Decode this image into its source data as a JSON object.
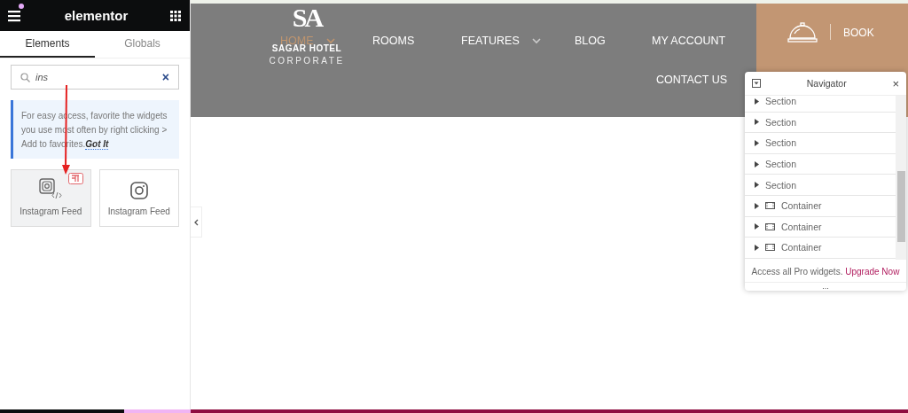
{
  "sidebar": {
    "title": "elementor",
    "tabs": [
      {
        "label": "Elements",
        "selected": true
      },
      {
        "label": "Globals",
        "selected": false
      }
    ],
    "search": {
      "value": "ins",
      "clear": "×"
    },
    "tip": {
      "text": "For easy access, favorite the widgets you use most often by right clicking > Add to favorites.",
      "link": "Got It"
    },
    "widgets": [
      {
        "label": "Instagram Feed",
        "kind": "code",
        "pro": true,
        "hovered": true
      },
      {
        "label": "Instagram Feed",
        "kind": "plain",
        "pro": false,
        "hovered": false
      }
    ]
  },
  "header": {
    "logo": {
      "mark": "SA",
      "name": "SAGAR HOTEL",
      "sub": "CORPORATE"
    },
    "nav": [
      {
        "label": "HOME",
        "selected": true,
        "dropdown": true
      },
      {
        "label": "ROOMS",
        "selected": false,
        "dropdown": false
      },
      {
        "label": "FEATURES",
        "selected": false,
        "dropdown": true
      },
      {
        "label": "BLOG",
        "selected": false,
        "dropdown": false
      },
      {
        "label": "MY ACCOUNT",
        "selected": false,
        "dropdown": false
      },
      {
        "label": "CONTACT US",
        "selected": false,
        "dropdown": false
      }
    ],
    "book": "BOOK"
  },
  "navigator": {
    "title": "Navigator",
    "close": "×",
    "items": [
      {
        "label": "Section",
        "kind": "section"
      },
      {
        "label": "Section",
        "kind": "section"
      },
      {
        "label": "Section",
        "kind": "section"
      },
      {
        "label": "Section",
        "kind": "section"
      },
      {
        "label": "Section",
        "kind": "section"
      },
      {
        "label": "Container",
        "kind": "container"
      },
      {
        "label": "Container",
        "kind": "container"
      },
      {
        "label": "Container",
        "kind": "container"
      }
    ],
    "promo": "Access all Pro widgets.",
    "promo_link": "Upgrade Now",
    "more": "..."
  }
}
